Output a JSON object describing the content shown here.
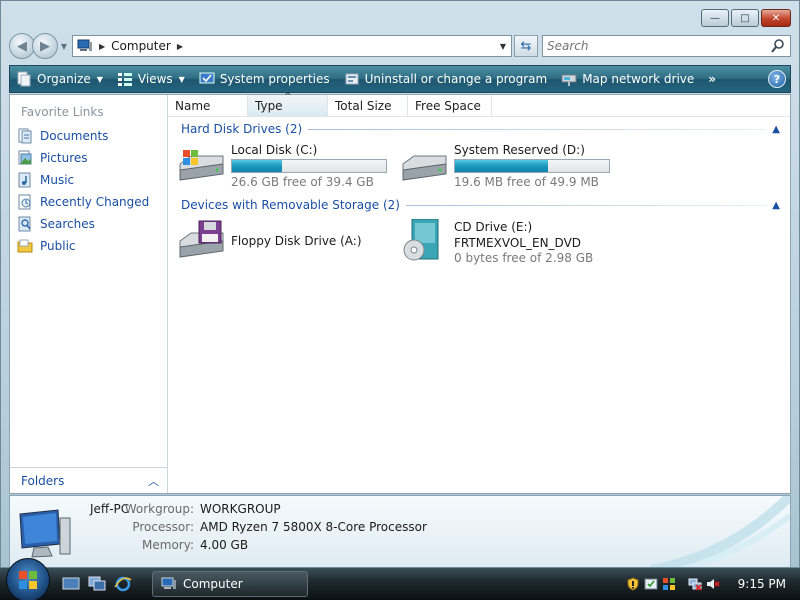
{
  "window": {
    "caption": {
      "minimize": "—",
      "maximize": "□",
      "close": "✕"
    }
  },
  "address": {
    "location": "Computer",
    "search_placeholder": "Search"
  },
  "commandbar": {
    "organize": "Organize",
    "views": "Views",
    "system_properties": "System properties",
    "uninstall": "Uninstall or change a program",
    "map_drive": "Map network drive",
    "more": "»",
    "help": "?"
  },
  "navpane": {
    "title": "Favorite Links",
    "items": [
      {
        "label": "Documents",
        "icon": "documents-icon"
      },
      {
        "label": "Pictures",
        "icon": "pictures-icon"
      },
      {
        "label": "Music",
        "icon": "music-icon"
      },
      {
        "label": "Recently Changed",
        "icon": "recently-changed-icon"
      },
      {
        "label": "Searches",
        "icon": "searches-icon"
      },
      {
        "label": "Public",
        "icon": "public-folder-icon"
      }
    ],
    "folders_label": "Folders"
  },
  "columns": [
    "Name",
    "Type",
    "Total Size",
    "Free Space"
  ],
  "groups": {
    "hard_disks": "Hard Disk Drives (2)",
    "removable": "Devices with Removable Storage (2)"
  },
  "drives": {
    "c": {
      "name": "Local Disk (C:)",
      "free_text": "26.6 GB free of 39.4 GB",
      "used_fraction": 0.325
    },
    "d": {
      "name": "System Reserved (D:)",
      "free_text": "19.6 MB free of 49.9 MB",
      "used_fraction": 0.607
    },
    "floppy": {
      "name": "Floppy Disk Drive (A:)"
    },
    "cd": {
      "name": "CD Drive (E:)",
      "label": "FRTMEXVOL_EN_DVD",
      "free_text": "0 bytes free of 2.98 GB"
    }
  },
  "details": {
    "hostname": "Jeff-PC",
    "workgroup_label": "Workgroup:",
    "workgroup": "WORKGROUP",
    "processor_label": "Processor:",
    "processor": "AMD Ryzen 7 5800X 8-Core Processor",
    "memory_label": "Memory:",
    "memory": "4.00 GB"
  },
  "taskbar": {
    "task_label": "Computer",
    "clock": "9:15 PM"
  },
  "colors": {
    "link": "#1a4fa3",
    "cmdbar": "#24657e",
    "progress": "#1a97be"
  }
}
